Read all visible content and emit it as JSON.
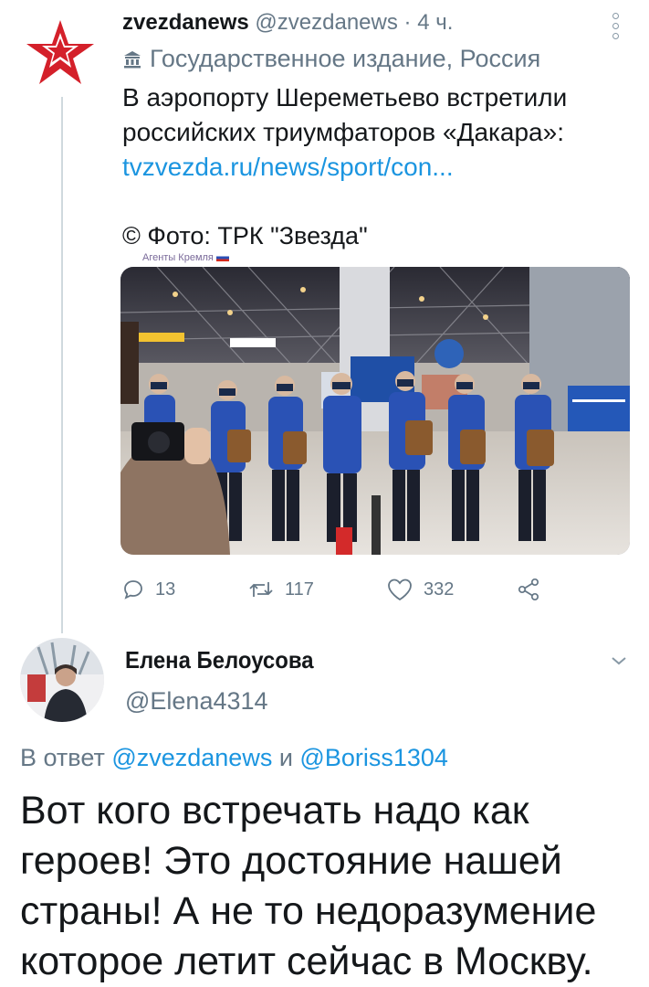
{
  "tweet": {
    "author_name": "zvezdanews",
    "author_handle": "@zvezdanews",
    "separator": "·",
    "time": "4 ч.",
    "label": "Государственное издание, Россия",
    "text": "В аэропорту Шереметьево встретили российских триумфаторов «Дакара»:",
    "link": "tvzvezda.ru/news/sport/con...",
    "photo_credit": "© Фото: ТРК \"Звезда\"",
    "watermark": "Агенты Кремля",
    "actions": {
      "replies": "13",
      "retweets": "117",
      "likes": "332"
    },
    "icons": {
      "avatar": "star-logo-icon",
      "more": "more-vertical-icon",
      "label": "government-building-icon",
      "reply": "reply-icon",
      "retweet": "retweet-icon",
      "like": "heart-icon",
      "share": "share-icon"
    }
  },
  "reply": {
    "author_name": "Елена Белоусова",
    "author_handle": "@Elena4314",
    "in_reply_prefix": "В ответ ",
    "mention1": "@zvezdanews",
    "conj": " и ",
    "mention2": "@Boriss1304",
    "text": "Вот кого встречать надо как героев! Это достояние нашей страны! А не то недоразумение которое летит сейчас в Москву."
  },
  "colors": {
    "text": "#14171a",
    "muted": "#657786",
    "link": "#1b95e0",
    "brand_red": "#d4202a"
  }
}
